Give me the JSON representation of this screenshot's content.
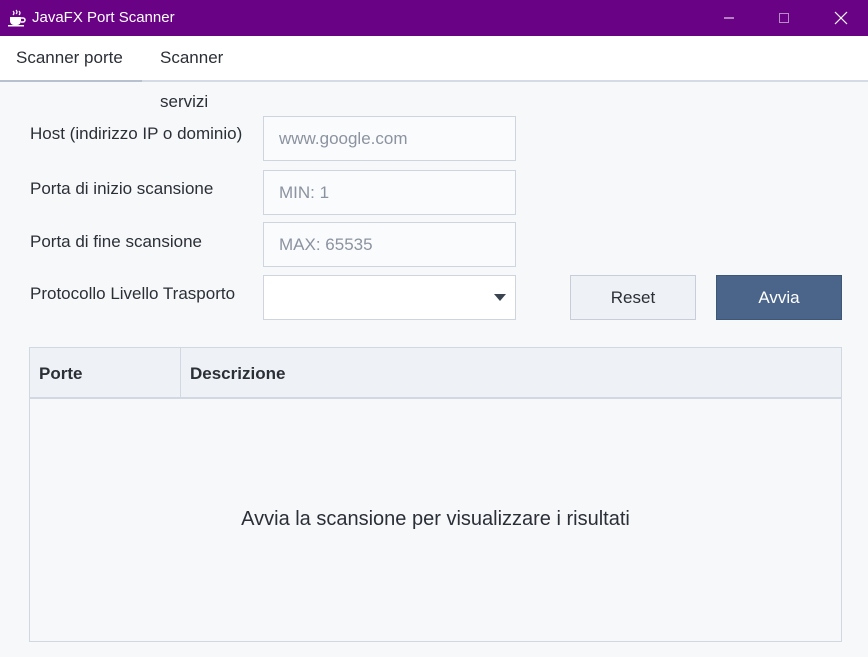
{
  "window": {
    "title": "JavaFX Port Scanner",
    "icon": "java-cup-icon",
    "titlebar_color": "#6a0286"
  },
  "tabs": [
    {
      "label": "Scanner porte",
      "selected": true
    },
    {
      "label": "Scanner servizi",
      "selected": false
    }
  ],
  "form": {
    "host": {
      "label": "Host (indirizzo IP o dominio)",
      "placeholder": "www.google.com",
      "value": ""
    },
    "start_port": {
      "label": "Porta di inizio scansione",
      "placeholder": "MIN: 1",
      "value": ""
    },
    "end_port": {
      "label": "Porta di fine scansione",
      "placeholder": "MAX: 65535",
      "value": ""
    },
    "protocol": {
      "label": "Protocollo Livello Trasporto",
      "value": ""
    }
  },
  "buttons": {
    "reset": "Reset",
    "avvia": "Avvia",
    "primary_color": "#4a6589"
  },
  "table": {
    "columns": [
      "Porte",
      "Descrizione"
    ],
    "rows": [],
    "empty_message": "Avvia la scansione per visualizzare i risultati"
  }
}
